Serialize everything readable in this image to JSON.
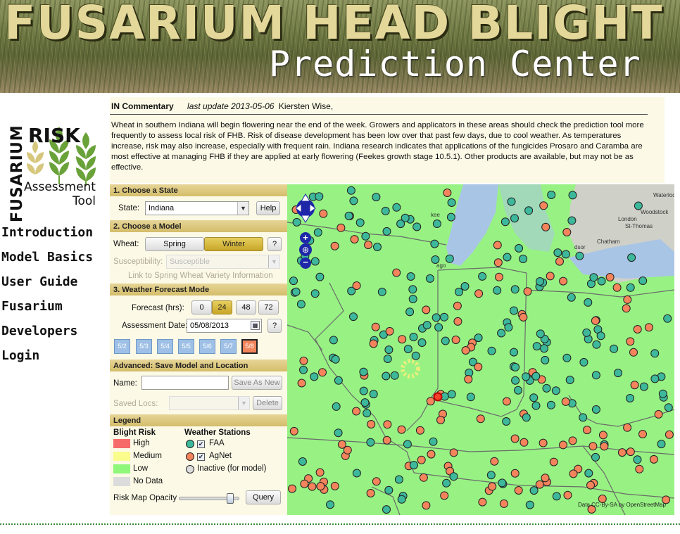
{
  "banner": {
    "title": "FUSARIUM HEAD BLIGHT",
    "subtitle": "Prediction Center"
  },
  "logo": {
    "vertical": "FUSARIUM",
    "risk": "RISK",
    "assessment": "Assessment",
    "tool": "Tool"
  },
  "nav": [
    "Introduction",
    "Model Basics",
    "User Guide",
    "Fusarium",
    "Developers",
    "Login"
  ],
  "commentary": {
    "heading": "IN Commentary",
    "update_label": "last update 2013-05-06",
    "author": "Kiersten Wise,",
    "body": "Wheat in southern Indiana will begin flowering near the end of the week. Growers and applicators in these areas should check the prediction tool more frequently to assess local risk of FHB. Risk of disease development has been low over that past few days, due to cool weather. As temperatures increase, risk may also increase, especially with frequent rain. Indiana research indicates that applications of the fungicides Prosaro and Caramba are most effective at managing FHB if they are applied at early flowering (Feekes growth stage 10.5.1). Other products are available, but may not be as effective."
  },
  "state_section": {
    "heading": "1. Choose a State",
    "label": "State:",
    "value": "Indiana",
    "help": "Help"
  },
  "model_section": {
    "heading": "2. Choose a Model",
    "label": "Wheat:",
    "spring": "Spring",
    "winter": "Winter",
    "help": "?",
    "susceptibility_label": "Susceptibility:",
    "susceptibility_value": "Susceptible",
    "variety_link": "Link to Spring Wheat Variety Information"
  },
  "weather_section": {
    "heading": "3. Weather Forecast Mode",
    "forecast_label": "Forecast (hrs):",
    "forecast_options": [
      "0",
      "24",
      "48",
      "72"
    ],
    "forecast_selected": "24",
    "date_label": "Assessment Date:",
    "date_value": "05/08/2013",
    "help": "?",
    "days": [
      "5/2",
      "5/3",
      "5/4",
      "5/5",
      "5/6",
      "5/7",
      "5/8"
    ],
    "current_day": "5/8"
  },
  "advanced_section": {
    "heading": "Advanced: Save Model and Location",
    "name_label": "Name:",
    "save_button": "Save As New",
    "saved_label": "Saved Locs:",
    "delete_button": "Delete"
  },
  "legend": {
    "heading": "Legend",
    "risk_title": "Blight Risk",
    "high": "High",
    "medium": "Medium",
    "low": "Low",
    "nodata": "No Data",
    "stations_title": "Weather Stations",
    "faa": "FAA",
    "agnet": "AgNet",
    "inactive": "Inactive (for model)",
    "opacity_label": "Risk Map Opacity",
    "opacity_value": 0.88,
    "query_button": "Query",
    "colors": {
      "high": "#f76a6a",
      "medium": "#fafc8c",
      "low": "#8ff77a",
      "nodata": "#dcdcdc",
      "faa": "#3db89a",
      "agnet": "#f4845c",
      "inactive": "#dddddd"
    }
  },
  "map": {
    "places": [
      "Waterloo",
      "Woodstock",
      "London",
      "St-Thomas",
      "Chatham",
      "dsor",
      "kee",
      "ago"
    ],
    "attribution": "Data CC-By-SA by OpenStreetMap"
  }
}
